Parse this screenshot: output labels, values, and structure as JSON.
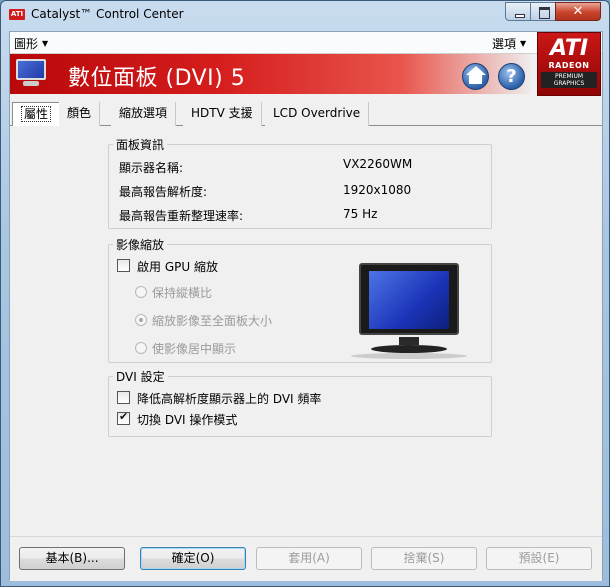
{
  "window": {
    "title": "Catalyst™ Control Center",
    "close_glyph": "✕"
  },
  "menubar": {
    "graphics": "圖形",
    "options": "選項"
  },
  "banner": {
    "title": "數位面板 (DVI) 5",
    "help_glyph": "?"
  },
  "logo": {
    "brand": "ATI",
    "product": "RADEON",
    "tier": "PREMIUM GRAPHICS"
  },
  "tabs": [
    "屬性",
    "顏色",
    "縮放選項",
    "HDTV 支援",
    "LCD Overdrive"
  ],
  "panel_info": {
    "legend": "面板資訊",
    "rows": [
      {
        "label": "顯示器名稱:",
        "value": "VX2260WM"
      },
      {
        "label": "最高報告解析度:",
        "value": "1920x1080"
      },
      {
        "label": "最高報告重新整理速率:",
        "value": "75 Hz"
      }
    ]
  },
  "scaling": {
    "legend": "影像縮放",
    "enable_gpu": "啟用 GPU 縮放",
    "enable_gpu_checked": false,
    "options": [
      {
        "label": "保持縱橫比",
        "selected": false
      },
      {
        "label": "縮放影像至全面板大小",
        "selected": true
      },
      {
        "label": "使影像居中顯示",
        "selected": false
      }
    ]
  },
  "dvi": {
    "legend": "DVI 設定",
    "reduce_freq": "降低高解析度顯示器上的 DVI 頻率",
    "reduce_freq_checked": false,
    "toggle_mode": "切換 DVI 操作模式",
    "toggle_mode_checked": true
  },
  "buttons": {
    "basic": "基本(B)...",
    "ok": "確定(O)",
    "apply": "套用(A)",
    "discard": "捨棄(S)",
    "defaults": "預設(E)"
  }
}
